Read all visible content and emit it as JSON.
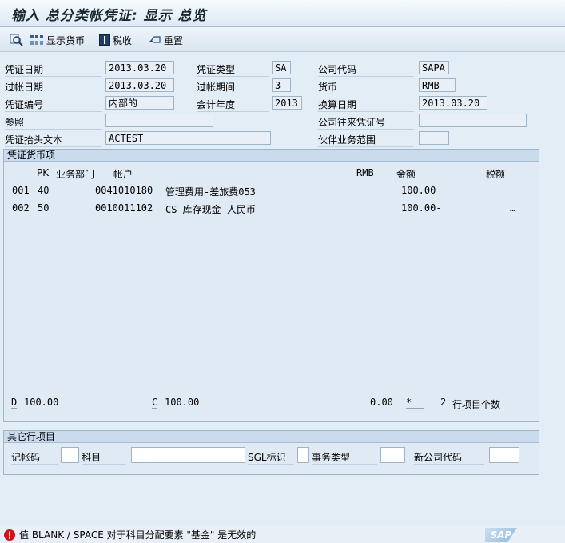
{
  "title": "输入 总分类帐凭证: 显示 总览",
  "toolbar": {
    "display_currency": "显示货币",
    "tax": "税收",
    "reset": "重置"
  },
  "header": {
    "doc_date_label": "凭证日期",
    "doc_date": "2013.03.20",
    "doc_type_label": "凭证类型",
    "doc_type": "SA",
    "company_code_label": "公司代码",
    "company_code": "SAPA",
    "posting_date_label": "过帐日期",
    "posting_date": "2013.03.20",
    "period_label": "过帐期间",
    "period": "3",
    "currency_label": "货币",
    "currency": "RMB",
    "doc_number_label": "凭证编号",
    "doc_number": "内部的",
    "fiscal_year_label": "会计年度",
    "fiscal_year": "2013",
    "translation_date_label": "换算日期",
    "translation_date": "2013.03.20",
    "reference_label": "参照",
    "reference": "",
    "intercompany_label": "公司往来凭证号",
    "intercompany": "",
    "header_text_label": "凭证抬头文本",
    "header_text": "ACTEST",
    "trading_partner_label": "伙伴业务范围",
    "trading_partner": ""
  },
  "items": {
    "group_title": "凭证货币项",
    "col_pk": "PK",
    "col_dept": "业务部门",
    "col_account": "帐户",
    "col_currency": "RMB",
    "col_amount": "金额",
    "col_tax": "税额",
    "rows": [
      {
        "no": "001",
        "pk": "40",
        "account": "0041010180",
        "desc": "管理费用-差旅费053",
        "amount": "100.00",
        "tax": ""
      },
      {
        "no": "002",
        "pk": "50",
        "account": "0010011102",
        "desc": "CS-库存现金-人民币",
        "amount": "100.00-",
        "tax": "…"
      }
    ],
    "debit_label": "D",
    "debit_total": "100.00",
    "credit_label": "C",
    "credit_total": "100.00",
    "balance": "0.00",
    "balance_flag": "*",
    "item_count": "2",
    "item_count_label": "行项目个数"
  },
  "other": {
    "group_title": "其它行项目",
    "posting_key_label": "记帐码",
    "account_label": "科目",
    "sgl_label": "SGL标识",
    "trans_type_label": "事务类型",
    "new_cc_label": "新公司代码"
  },
  "status": {
    "message": "值 BLANK / SPACE 对于科目分配要素 \"基金\" 是无效的",
    "logo": "SAP"
  }
}
